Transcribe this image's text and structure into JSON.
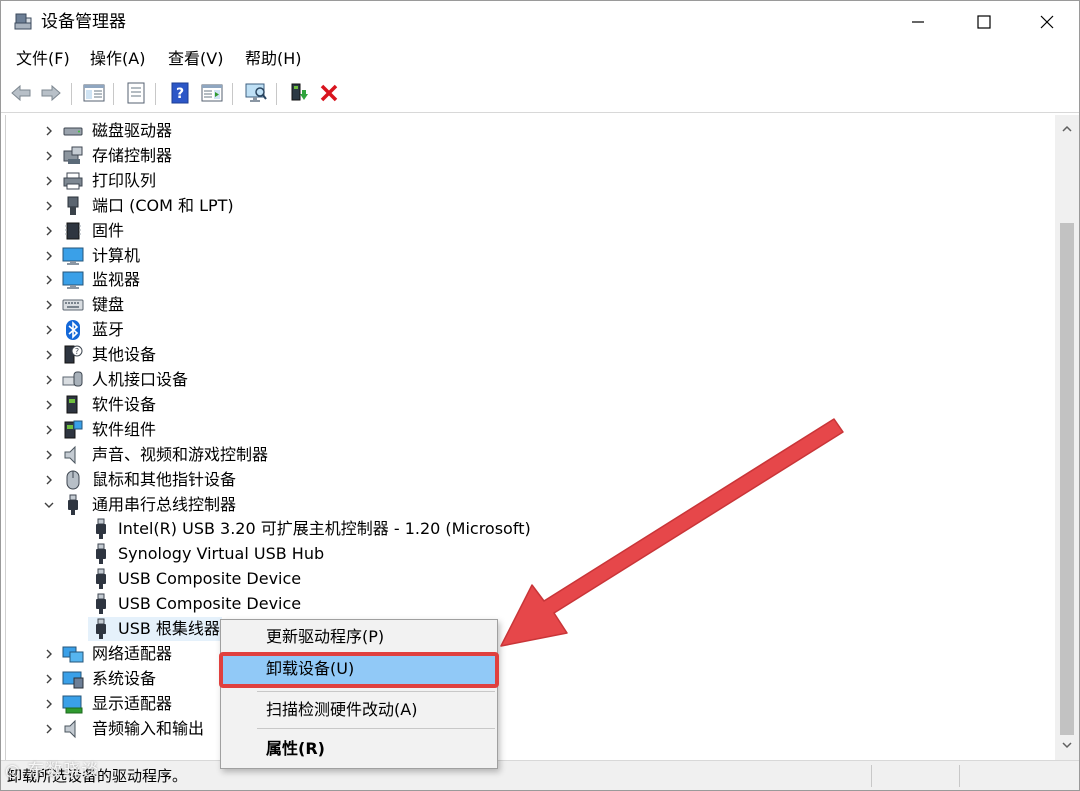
{
  "window": {
    "title": "设备管理器"
  },
  "menu": [
    "文件(F)",
    "操作(A)",
    "查看(V)",
    "帮助(H)"
  ],
  "toolbar": {
    "buttons": [
      "back-icon",
      "forward-icon",
      "console-tree-icon",
      "properties-icon",
      "help-icon",
      "action-pane-icon",
      "scan-hardware-icon",
      "update-driver-icon",
      "uninstall-icon"
    ]
  },
  "tree": {
    "categories_top": [
      {
        "label": "磁盘驱动器",
        "icon": "disk-drive-icon"
      },
      {
        "label": "存储控制器",
        "icon": "storage-controller-icon"
      },
      {
        "label": "打印队列",
        "icon": "printer-icon"
      },
      {
        "label": "端口 (COM 和 LPT)",
        "icon": "port-icon"
      },
      {
        "label": "固件",
        "icon": "firmware-icon"
      },
      {
        "label": "计算机",
        "icon": "computer-icon"
      },
      {
        "label": "监视器",
        "icon": "monitor-icon"
      },
      {
        "label": "键盘",
        "icon": "keyboard-icon"
      },
      {
        "label": "蓝牙",
        "icon": "bluetooth-icon"
      },
      {
        "label": "其他设备",
        "icon": "other-device-icon"
      },
      {
        "label": "人机接口设备",
        "icon": "hid-icon"
      },
      {
        "label": "软件设备",
        "icon": "software-device-icon"
      },
      {
        "label": "软件组件",
        "icon": "software-component-icon"
      },
      {
        "label": "声音、视频和游戏控制器",
        "icon": "sound-icon"
      },
      {
        "label": "鼠标和其他指针设备",
        "icon": "mouse-icon"
      }
    ],
    "expanded": {
      "label": "通用串行总线控制器",
      "icon": "usb-icon",
      "children": [
        "Intel(R) USB 3.20 可扩展主机控制器 - 1.20 (Microsoft)",
        "Synology Virtual USB Hub",
        "USB Composite Device",
        "USB Composite Device",
        "USB 根集线器"
      ]
    },
    "categories_bottom": [
      {
        "label": "网络适配器",
        "icon": "network-adapter-icon"
      },
      {
        "label": "系统设备",
        "icon": "system-device-icon"
      },
      {
        "label": "显示适配器",
        "icon": "display-adapter-icon"
      },
      {
        "label": "音频输入和输出",
        "icon": "audio-io-icon"
      }
    ]
  },
  "context_menu": {
    "items": [
      "更新驱动程序(P)",
      "卸载设备(U)",
      "扫描检测硬件改动(A)",
      "属性(R)"
    ],
    "highlighted": "卸载设备(U)"
  },
  "status": {
    "text": "卸载所选设备的驱动程序。"
  },
  "watermark": "◎ 东数晓谈",
  "colors": {
    "highlight": "#91c9f7",
    "annotation_red": "#e0403e",
    "selection": "#e5f1fb"
  }
}
